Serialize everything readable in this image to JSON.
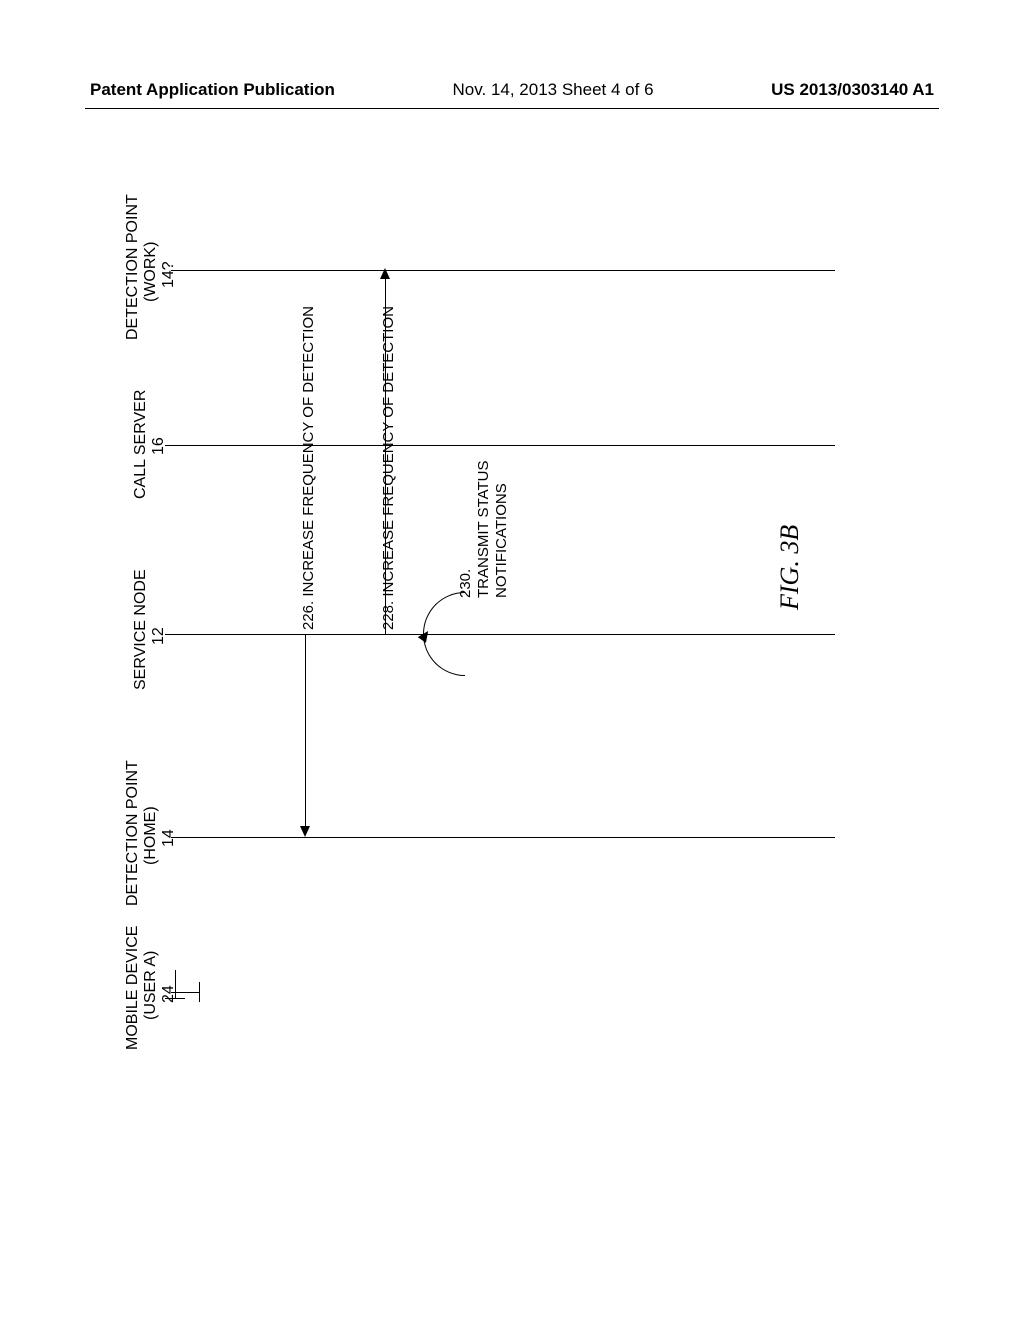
{
  "header": {
    "left": "Patent Application Publication",
    "mid": "Nov. 14, 2013  Sheet 4 of 6",
    "right": "US 2013/0303140 A1"
  },
  "lanes": {
    "mobile": {
      "l1": "MOBILE DEVICE",
      "l2": "(USER A)",
      "l3": "24"
    },
    "dp_home": {
      "l1": "DETECTION POINT",
      "l2": "(HOME)",
      "l3": "14"
    },
    "service": {
      "l1": "SERVICE NODE",
      "l2": "12"
    },
    "call": {
      "l1": "CALL SERVER",
      "l2": "16"
    },
    "dp_work": {
      "l1": "DETECTION POINT",
      "l2": "(WORK)",
      "l3": "14?"
    }
  },
  "messages": {
    "m226": "226.    INCREASE FREQUENCY OF DETECTION",
    "m228": "228.    INCREASE FREQUENCY OF DETECTION",
    "m230a": "230.",
    "m230b": "TRANSMIT STATUS",
    "m230c": "NOTIFICATIONS"
  },
  "figure": "FIG. 3B"
}
